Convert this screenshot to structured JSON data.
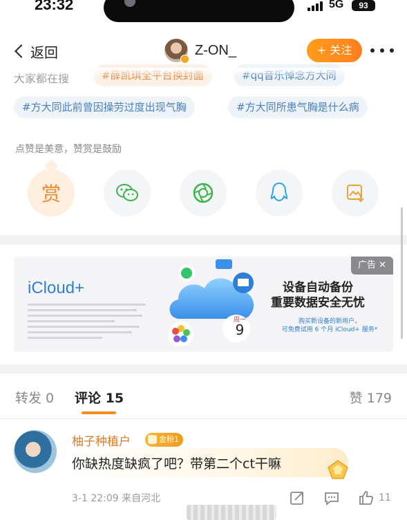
{
  "status_bar": {
    "time": "23:32",
    "network": "5G",
    "battery": "93"
  },
  "nav": {
    "back_label": "返回",
    "username": "Z-ON_",
    "follow_label": "+ 关注"
  },
  "hashtags": {
    "search_label": "大家都在搜",
    "row1": [
      "#薛凯琪全平台换封面",
      "#qq音乐悼念方大同"
    ],
    "row2": [
      "#方大同此前曾因操劳过度出现气胸",
      "#方大同所患气胸是什么病"
    ]
  },
  "reward": {
    "prompt": "点赞是美意，赞赏是鼓励",
    "reward_glyph": "赏"
  },
  "share_icons": [
    "reward-icon",
    "wechat-icon",
    "moments-icon",
    "qq-icon",
    "save-image-icon"
  ],
  "ad": {
    "tag": "广告 ✕",
    "brand": "iCloud+",
    "headline_line1": "设备自动备份",
    "headline_line2": "重要数据安全无忧",
    "sub_line1": "购买新设备的新用户，",
    "sub_line2": "可免费试用 6 个月 iCloud+ 服务*",
    "calendar_weekday": "周一",
    "calendar_day": "9"
  },
  "tabs": {
    "repost": "转发 0",
    "comment": "评论 15",
    "like": "赞 179"
  },
  "comment": {
    "name": "柚子种植户",
    "fan_badge": "金粉1",
    "text": "你缺热度缺疯了吧？带第二个ct干嘛",
    "meta": "3-1 22:09  来自河北",
    "like_count": "11"
  },
  "colors": {
    "accent": "#ff8a1e",
    "link": "#4a7fc1",
    "name": "#e07a20"
  }
}
